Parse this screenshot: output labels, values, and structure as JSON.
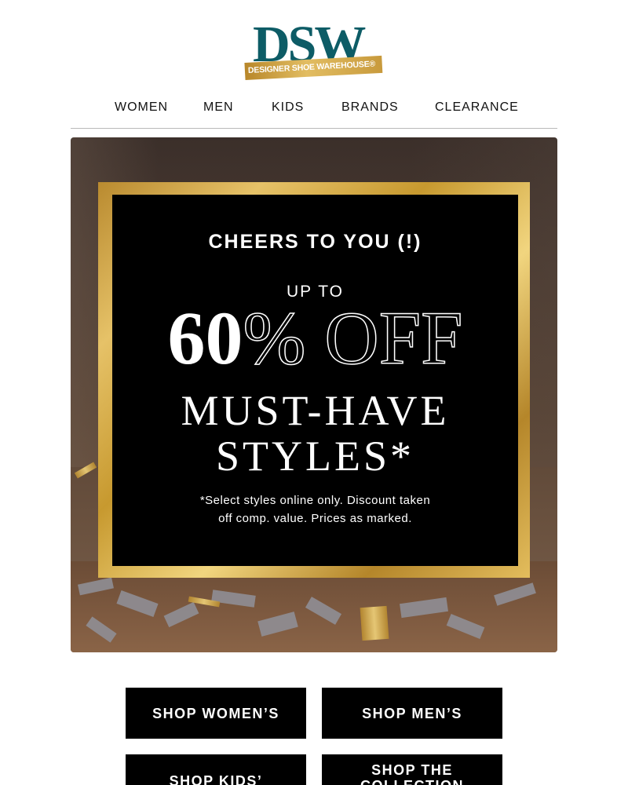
{
  "brand": {
    "name": "DSW",
    "tagline": "DESIGNER SHOE WAREHOUSE®",
    "primary_color": "#0d5c66",
    "gold_color": "#d4a94a"
  },
  "nav": {
    "items": [
      {
        "label": "WOMEN"
      },
      {
        "label": "MEN"
      },
      {
        "label": "KIDS"
      },
      {
        "label": "BRANDS"
      },
      {
        "label": "CLEARANCE"
      }
    ]
  },
  "hero": {
    "eyebrow": "CHEERS TO YOU (!)",
    "up_to": "UP TO",
    "discount_number": "60",
    "discount_suffix": "% OFF",
    "headline_line1": "MUST-HAVE",
    "headline_line2": "STYLES*",
    "fine_print_line1": "*Select styles online only. Discount taken",
    "fine_print_line2": "off comp. value. Prices as marked."
  },
  "cta": {
    "shop_womens": "SHOP WOMEN’S",
    "shop_mens": "SHOP MEN’S",
    "shop_kids": "SHOP KIDS’",
    "shop_collection": "SHOP THE COLLECTION"
  }
}
